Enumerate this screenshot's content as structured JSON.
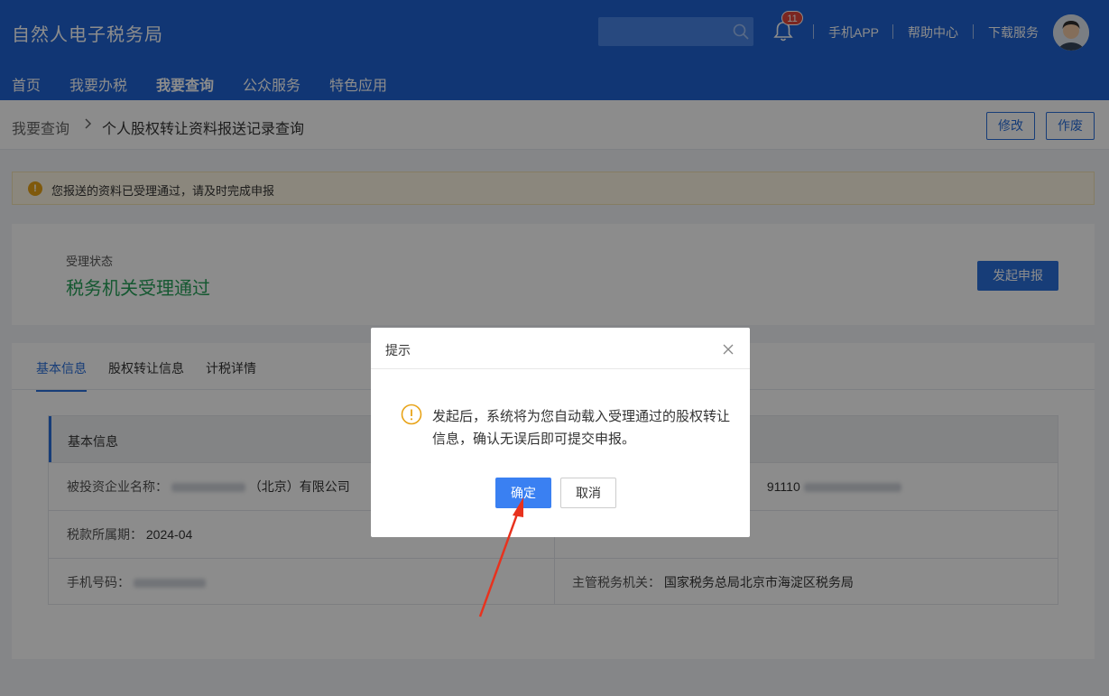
{
  "app": {
    "title": "自然人电子税务局"
  },
  "header": {
    "notification_count": "11",
    "links": {
      "mobile_app": "手机APP",
      "help_center": "帮助中心",
      "download_service": "下载服务"
    }
  },
  "nav": {
    "items": [
      "首页",
      "我要办税",
      "我要查询",
      "公众服务",
      "特色应用"
    ],
    "active": "我要查询"
  },
  "breadcrumb": {
    "parent": "我要查询",
    "separator": ">",
    "current": "个人股权转让资料报送记录查询"
  },
  "page_actions": {
    "modify": "修改",
    "void": "作废"
  },
  "notice": {
    "icon": "!",
    "text": "您报送的资料已受理通过，请及时完成申报"
  },
  "status": {
    "label": "受理状态",
    "value": "税务机关受理通过",
    "declare_button": "发起申报",
    "value_color": "#27a15a"
  },
  "tabs": {
    "items": [
      "基本信息",
      "股权转让信息",
      "计税详情"
    ],
    "active": "基本信息"
  },
  "basic_info": {
    "header": "基本信息",
    "company_label": "被投资企业名称：",
    "company_value_visible": "（北京）有限公司",
    "credit_code_visible": "91110",
    "tax_period_label": "税款所属期：",
    "tax_period_value": "2024-04",
    "phone_label": "手机号码：",
    "tax_authority_label": "主管税务机关：",
    "tax_authority_value": "国家税务总局北京市海淀区税务局"
  },
  "dialog": {
    "title": "提示",
    "message": "发起后，系统将为您自动载入受理通过的股权转让信息，确认无误后即可提交申报。",
    "confirm": "确定",
    "cancel": "取消"
  },
  "colors": {
    "header_bg": "#1f63d3",
    "primary": "#2a6fdb",
    "warning": "#e8a317",
    "annotation_arrow": "#e8321e"
  }
}
